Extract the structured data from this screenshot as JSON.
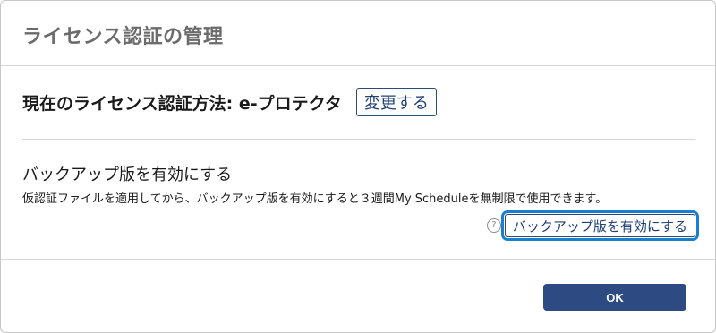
{
  "dialog": {
    "title": "ライセンス認証の管理"
  },
  "license_method": {
    "label": "現在のライセンス認証方法: e-プロテクタ",
    "change_button": "変更する"
  },
  "backup": {
    "title": "バックアップ版を有効にする",
    "description": "仮認証ファイルを適用してから、バックアップ版を有効にすると３週間My Scheduleを無制限で使用できます。",
    "help_icon_glyph": "?",
    "enable_button": "バックアップ版を有効にする"
  },
  "footer": {
    "ok_button": "OK"
  },
  "colors": {
    "primary": "#2d4a82",
    "focus_ring": "#1a7fd0",
    "title_gray": "#6b6b6b"
  }
}
